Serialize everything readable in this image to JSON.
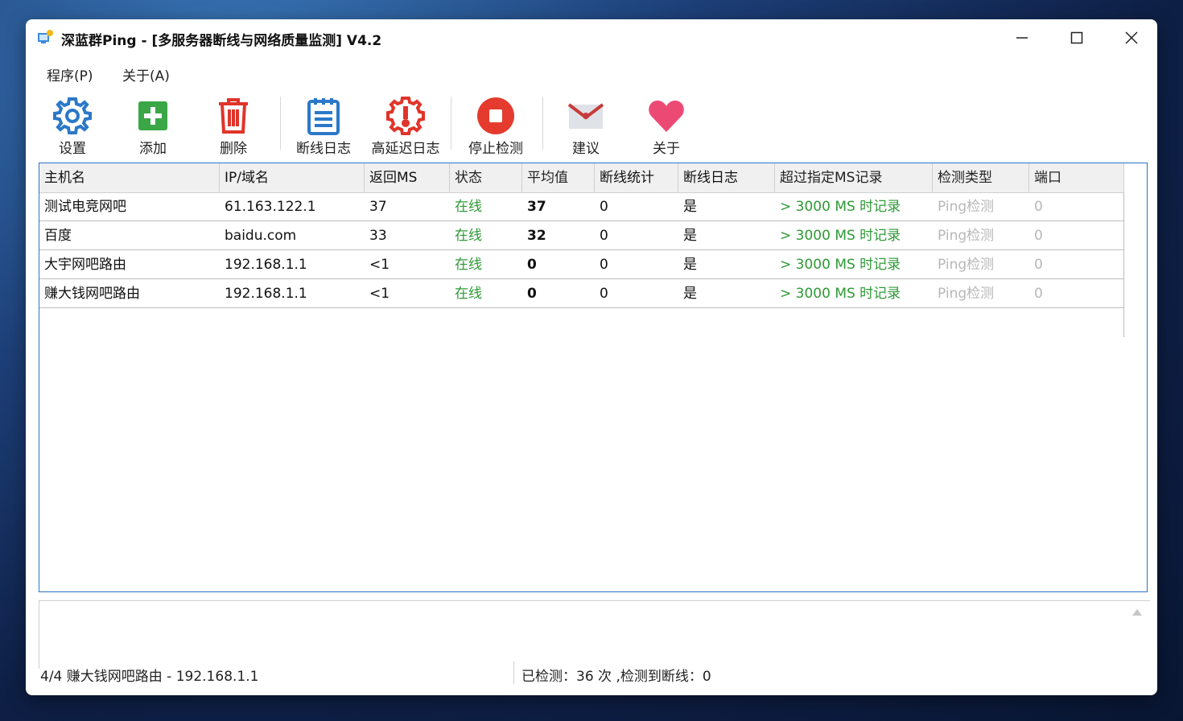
{
  "window": {
    "title": "深蓝群Ping - [多服务器断线与网络质量监测] V4.2"
  },
  "menu": [
    {
      "label": "程序(P)"
    },
    {
      "label": "关于(A)"
    }
  ],
  "toolbar": [
    {
      "label": "设置",
      "icon": "gear-icon"
    },
    {
      "label": "添加",
      "icon": "add-icon"
    },
    {
      "label": "删除",
      "icon": "trash-icon"
    },
    {
      "label": "断线日志",
      "icon": "notepad-icon"
    },
    {
      "label": "高延迟日志",
      "icon": "thermometer-icon"
    },
    {
      "label": "停止检测",
      "icon": "stop-icon"
    },
    {
      "label": "建议",
      "icon": "envelope-icon"
    },
    {
      "label": "关于",
      "icon": "heart-icon"
    }
  ],
  "table": {
    "columns": [
      "主机名",
      "IP/域名",
      "返回MS",
      "状态",
      "平均值",
      "断线统计",
      "断线日志",
      "超过指定MS记录",
      "检测类型",
      "端口"
    ],
    "rows": [
      {
        "host": "测试电竞网吧",
        "ip": "61.163.122.1",
        "ms": "37",
        "status": "在线",
        "avg": "37",
        "drops": "0",
        "log": "是",
        "over": "> 3000 MS 时记录",
        "type": "Ping检测",
        "port": "0"
      },
      {
        "host": "百度",
        "ip": "baidu.com",
        "ms": "33",
        "status": "在线",
        "avg": "32",
        "drops": "0",
        "log": "是",
        "over": "> 3000 MS 时记录",
        "type": "Ping检测",
        "port": "0"
      },
      {
        "host": "大宇网吧路由",
        "ip": "192.168.1.1",
        "ms": "<1",
        "status": "在线",
        "avg": "0",
        "drops": "0",
        "log": "是",
        "over": "> 3000 MS 时记录",
        "type": "Ping检测",
        "port": "0"
      },
      {
        "host": "赚大钱网吧路由",
        "ip": "192.168.1.1",
        "ms": "<1",
        "status": "在线",
        "avg": "0",
        "drops": "0",
        "log": "是",
        "over": "> 3000 MS 时记录",
        "type": "Ping检测",
        "port": "0"
      }
    ]
  },
  "statusbar": {
    "left": "4/4 赚大钱网吧路由 - 192.168.1.1",
    "right": "已检测：36 次 ,检测到断线：0"
  },
  "colors": {
    "online": "#2e9a36",
    "muted": "#b8b8b8",
    "grid_border": "#2a74c8",
    "stop_red": "#e53b2f",
    "gear_blue": "#2b78c8",
    "add_green": "#3aa646"
  }
}
